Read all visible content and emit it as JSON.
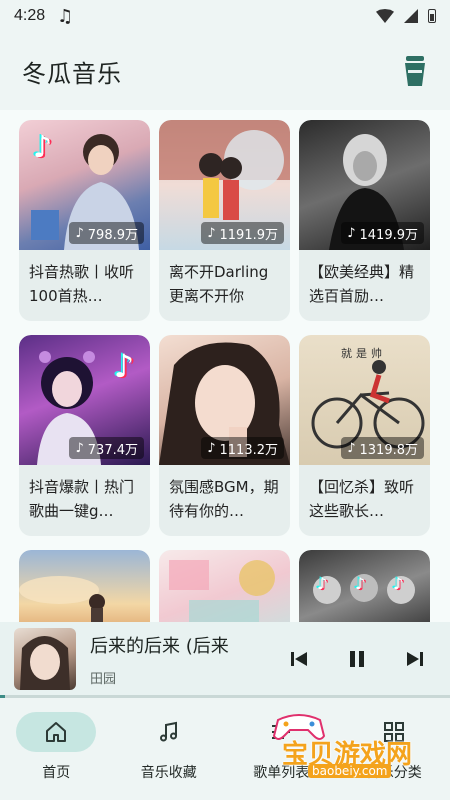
{
  "status_bar": {
    "time": "4:28",
    "music_glyph": "♫"
  },
  "header": {
    "title": "冬瓜音乐",
    "action_icon": "cup-icon"
  },
  "playlists": [
    {
      "title": "抖音热歌丨收听100首热…",
      "plays": "798.9万",
      "cover": "tiktok-male-singer"
    },
    {
      "title": "离不开Darling 更离不开你",
      "plays": "1191.9万",
      "cover": "couple-illustration"
    },
    {
      "title": "【欧美经典】精选百首励…",
      "plays": "1419.9万",
      "cover": "blonde-singer-bw"
    },
    {
      "title": "抖音爆款丨热门歌曲一键g…",
      "plays": "737.4万",
      "cover": "tiktok-girl-headphones"
    },
    {
      "title": "氛围感BGM，期待有你的…",
      "plays": "1113.2万",
      "cover": "girl-portrait"
    },
    {
      "title": "【回忆杀】致听这些歌长…",
      "plays": "1319.8万",
      "cover": "bicycle-sketch"
    },
    {
      "title": "",
      "plays": "",
      "cover": "sunset-clouds"
    },
    {
      "title": "",
      "plays": "",
      "cover": "pink-collage"
    },
    {
      "title": "",
      "plays": "",
      "cover": "tiktok-boys-bw"
    }
  ],
  "cover_captions": {
    "bicycle": "就是帅"
  },
  "player": {
    "title": "后来的后来 (后来",
    "artist": "田园",
    "progress": 0.0,
    "prev_icon": "skip-previous-icon",
    "pause_icon": "pause-icon",
    "next_icon": "skip-next-icon"
  },
  "nav": [
    {
      "label": "首页",
      "icon": "home-icon",
      "active": true
    },
    {
      "label": "音乐收藏",
      "icon": "music-note-icon",
      "active": false
    },
    {
      "label": "歌单列表",
      "icon": "list-icon",
      "active": false
    },
    {
      "label": "音乐分类",
      "icon": "grid-icon",
      "active": false
    }
  ],
  "watermark": {
    "text": "宝贝游戏网",
    "url": "baobeiy.com"
  },
  "colors": {
    "accent": "#3d8c86",
    "nav_active_bg": "#c6e6e1",
    "watermark": "#f4a31c"
  }
}
